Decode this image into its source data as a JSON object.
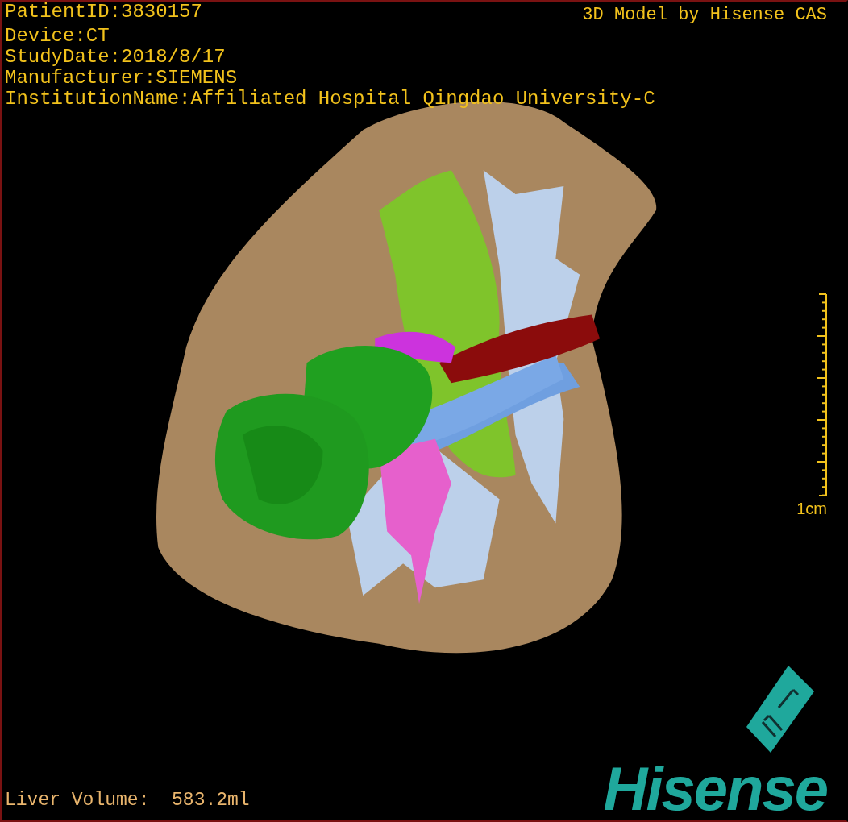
{
  "header": {
    "info_lines": [
      "PatientID:3830157",
      "Device:CT",
      "StudyDate:2018/8/17",
      "Manufacturer:SIEMENS",
      "InstitutionName:Affiliated Hospital Qingdao University-C"
    ],
    "title": "3D Model by Hisense CAS"
  },
  "scale_bar": {
    "label": "1cm"
  },
  "volume": "Liver Volume:  583.2ml",
  "logo": {
    "wordmark": "Hisense"
  }
}
